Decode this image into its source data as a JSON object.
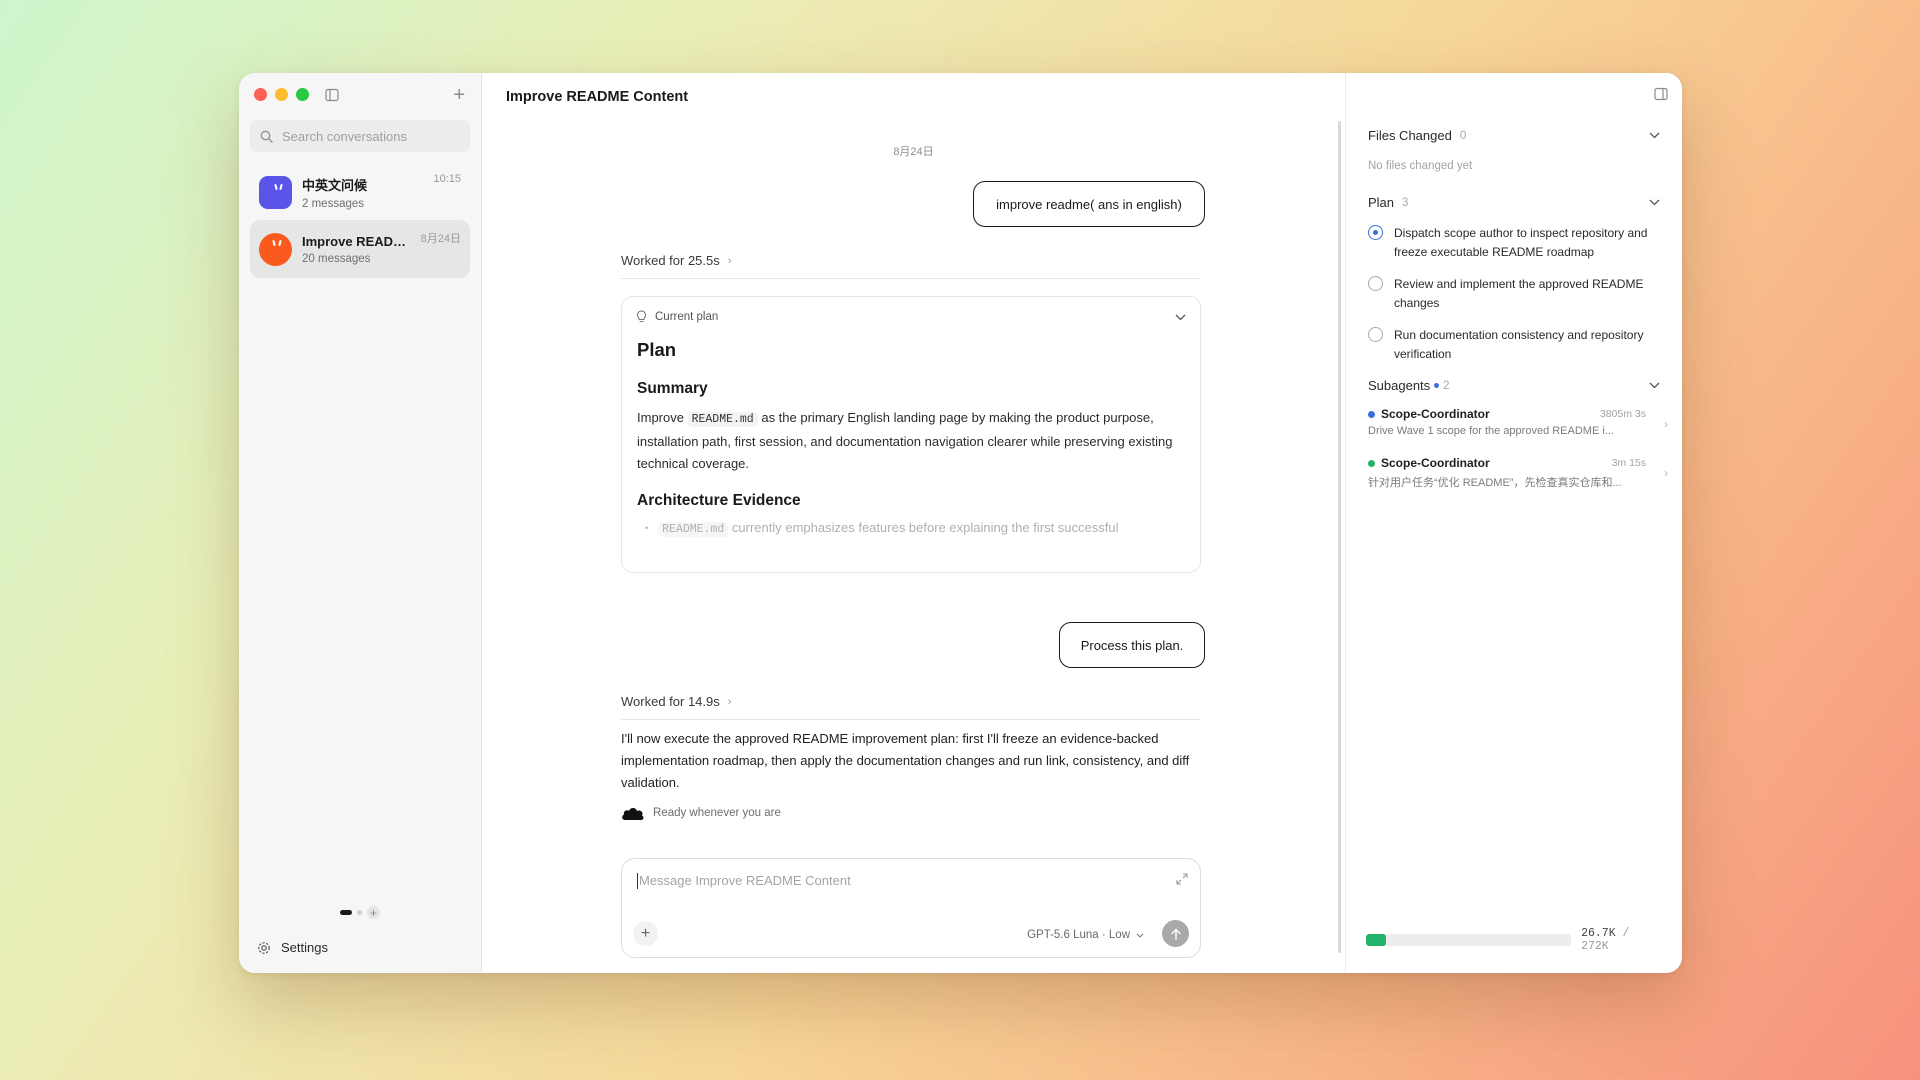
{
  "sidebar": {
    "search_placeholder": "Search conversations",
    "conversations": [
      {
        "title": "中英文问候",
        "count": "2 messages",
        "time": "10:15",
        "avatar_color": "#5b54e8",
        "active": false
      },
      {
        "title": "Improve READM...",
        "count": "20 messages",
        "time": "8月24日",
        "avatar_color": "#fb5a1f",
        "active": true
      }
    ],
    "settings_label": "Settings"
  },
  "main": {
    "title": "Improve README Content",
    "date": "8月24日",
    "user_message_1": "improve readme( ans in english)",
    "worked_1": "Worked for 25.5s",
    "plan_card": {
      "header": "Current plan",
      "heading": "Plan",
      "summary_heading": "Summary",
      "summary_pre": "Improve",
      "summary_code": "README.md",
      "summary_post": "as the primary English landing page by making the product purpose, installation path, first session, and documentation navigation clearer while preserving existing technical coverage.",
      "evidence_heading": "Architecture Evidence",
      "evidence_code": "README.md",
      "evidence_text": "currently emphasizes features before explaining the first successful"
    },
    "user_message_2": "Process this plan.",
    "worked_2": "Worked for 14.9s",
    "assistant_reply": "I'll now execute the approved README improvement plan: first I'll freeze an evidence-backed implementation roadmap, then apply the documentation changes and run link, consistency, and diff validation.",
    "status": "Ready whenever you are",
    "composer": {
      "placeholder": "Message Improve README Content",
      "model": "GPT-5.6 Luna · Low"
    }
  },
  "right_panel": {
    "files_changed": {
      "label": "Files Changed",
      "count": "0",
      "empty": "No files changed yet"
    },
    "plan": {
      "label": "Plan",
      "count": "3",
      "items": [
        {
          "text": "Dispatch scope author to inspect repository and freeze executable README roadmap",
          "status": "in-progress"
        },
        {
          "text": "Review and implement the approved README changes",
          "status": "pending"
        },
        {
          "text": "Run documentation consistency and repository verification",
          "status": "pending"
        }
      ]
    },
    "subagents": {
      "label": "Subagents",
      "count": "2",
      "items": [
        {
          "name": "Scope-Coordinator",
          "duration": "3805m 3s",
          "desc": "Drive Wave 1 scope for the approved README i...",
          "color": "#3b6fd9"
        },
        {
          "name": "Scope-Coordinator",
          "duration": "3m 15s",
          "desc": "针对用户任务“优化 README”，先检查真实仓库和...",
          "color": "#22b26b"
        }
      ]
    },
    "usage": {
      "used": "26.7K",
      "separator": "/",
      "total": "272K",
      "fraction": 0.098
    }
  },
  "colors": {
    "accent_blue": "#3b6fd9",
    "accent_green": "#22b26b"
  }
}
